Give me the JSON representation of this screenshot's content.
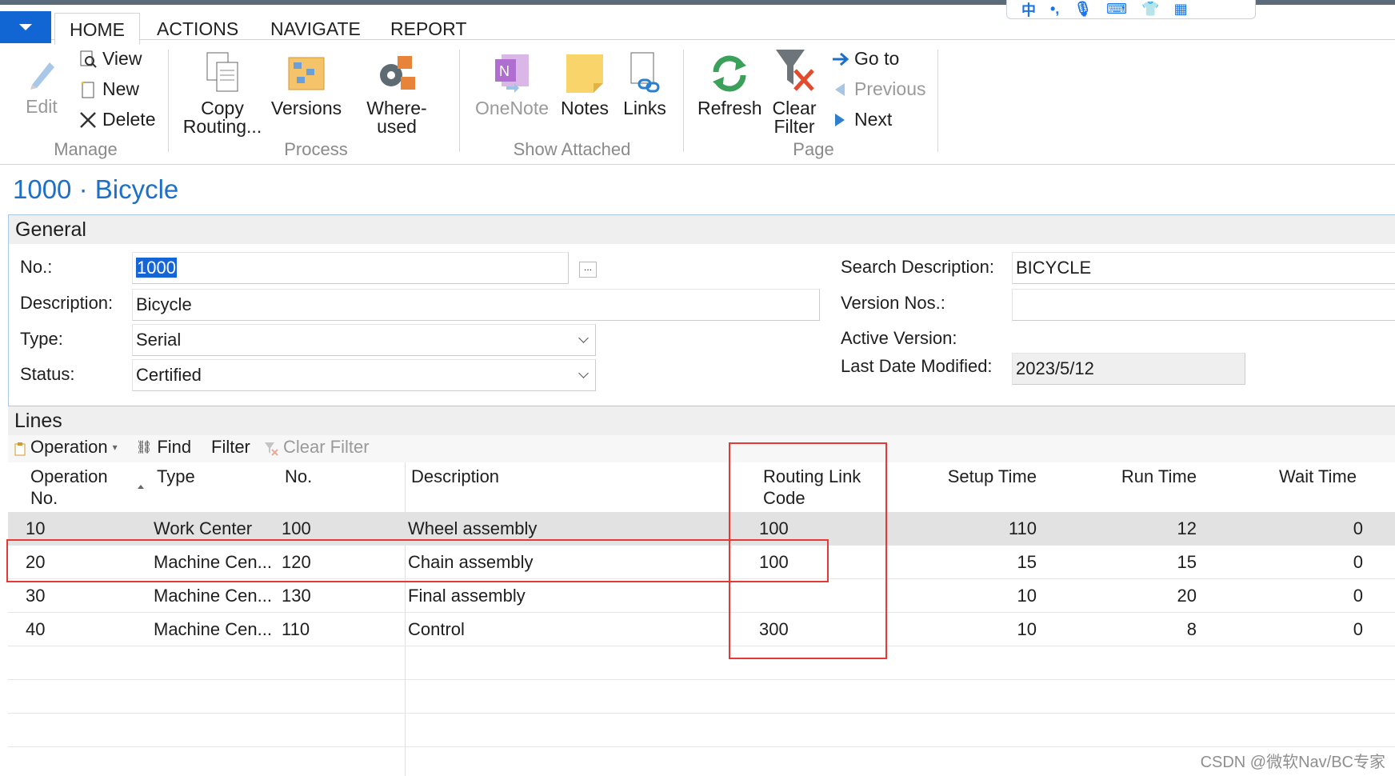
{
  "ribbon_tabs": [
    "HOME",
    "ACTIONS",
    "NAVIGATE",
    "REPORT"
  ],
  "ribbon": {
    "manage": {
      "label": "Manage",
      "edit": "Edit",
      "view": "View",
      "new": "New",
      "delete": "Delete"
    },
    "process": {
      "label": "Process",
      "copy_routing_1": "Copy",
      "copy_routing_2": "Routing...",
      "versions": "Versions",
      "where_used": "Where-used"
    },
    "show_attached": {
      "label": "Show Attached",
      "onenote": "OneNote",
      "notes": "Notes",
      "links": "Links"
    },
    "page": {
      "label": "Page",
      "refresh": "Refresh",
      "clear_filter_1": "Clear",
      "clear_filter_2": "Filter",
      "goto": "Go to",
      "previous": "Previous",
      "next": "Next"
    }
  },
  "ime_bar": {
    "chinese_char": "中"
  },
  "page_title": "1000 · Bicycle",
  "general": {
    "header": "General",
    "no_label": "No.:",
    "no_value": "1000",
    "description_label": "Description:",
    "description_value": "Bicycle",
    "type_label": "Type:",
    "type_value": "Serial",
    "status_label": "Status:",
    "status_value": "Certified",
    "search_desc_label": "Search Description:",
    "search_desc_value": "BICYCLE",
    "version_nos_label": "Version Nos.:",
    "version_nos_value": "",
    "active_version_label": "Active Version:",
    "last_modified_label": "Last Date Modified:",
    "last_modified_value": "2023/5/12",
    "ellipsis": "..."
  },
  "lines": {
    "header": "Lines",
    "toolbar": {
      "operation": "Operation",
      "find": "Find",
      "filter": "Filter",
      "clear_filter": "Clear Filter"
    },
    "columns": {
      "op_no_1": "Operation",
      "op_no_2": "No.",
      "type": "Type",
      "no": "No.",
      "description": "Description",
      "routing_link_1": "Routing Link",
      "routing_link_2": "Code",
      "setup_time": "Setup Time",
      "run_time": "Run Time",
      "wait_time": "Wait Time"
    },
    "rows": [
      {
        "op_no": "10",
        "type": "Work Center",
        "no": "100",
        "description": "Wheel assembly",
        "routing_link": "100",
        "setup_time": "110",
        "run_time": "12",
        "wait_time": "0"
      },
      {
        "op_no": "20",
        "type": "Machine Cen...",
        "no": "120",
        "description": "Chain assembly",
        "routing_link": "100",
        "setup_time": "15",
        "run_time": "15",
        "wait_time": "0"
      },
      {
        "op_no": "30",
        "type": "Machine Cen...",
        "no": "130",
        "description": "Final assembly",
        "routing_link": "",
        "setup_time": "10",
        "run_time": "20",
        "wait_time": "0"
      },
      {
        "op_no": "40",
        "type": "Machine Cen...",
        "no": "110",
        "description": "Control",
        "routing_link": "300",
        "setup_time": "10",
        "run_time": "8",
        "wait_time": "0"
      }
    ]
  },
  "watermark": "CSDN @微软Nav/BC专家",
  "colors": {
    "accent": "#1266d4",
    "title": "#1d6fc7",
    "highlight": "#e53935"
  }
}
